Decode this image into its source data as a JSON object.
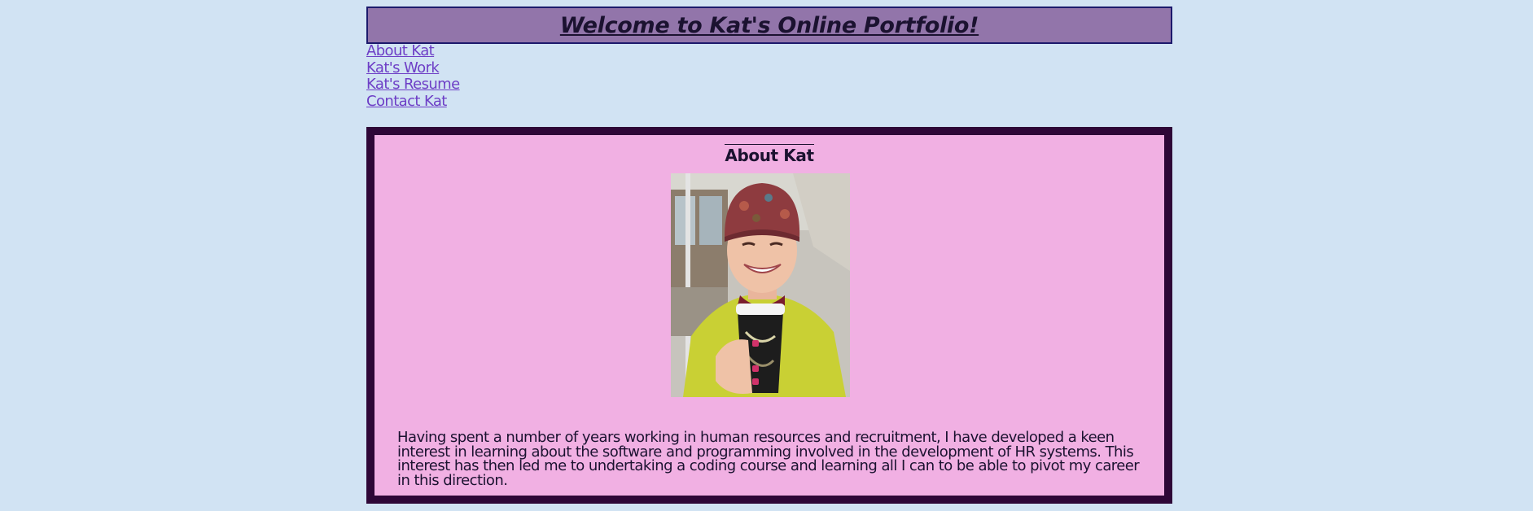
{
  "header": {
    "title": "Welcome to Kat's Online Portfolio!"
  },
  "nav": {
    "items": [
      {
        "label": "About Kat"
      },
      {
        "label": "Kat's Work"
      },
      {
        "label": "Kat's Resume"
      },
      {
        "label": "Contact Kat"
      }
    ]
  },
  "about": {
    "heading": "About Kat",
    "photo_subject": "portrait of Kat in a knitted beanie holding a coffee cup",
    "paragraph": "Having spent a number of years working in human resources and recruitment, I have developed a keen interest in learning about the software and programming involved in the development of HR systems. This interest has then led me to undertaking a coding course and learning all I can to be able to pivot my career in this direction."
  },
  "colors": {
    "page_background": "#d1e3f3",
    "header_background": "#9275aa",
    "header_border": "#1c1a6c",
    "link": "#6d3ec6",
    "about_background": "#f1b0e3",
    "about_border": "#2e0737",
    "text": "#1b1230"
  }
}
